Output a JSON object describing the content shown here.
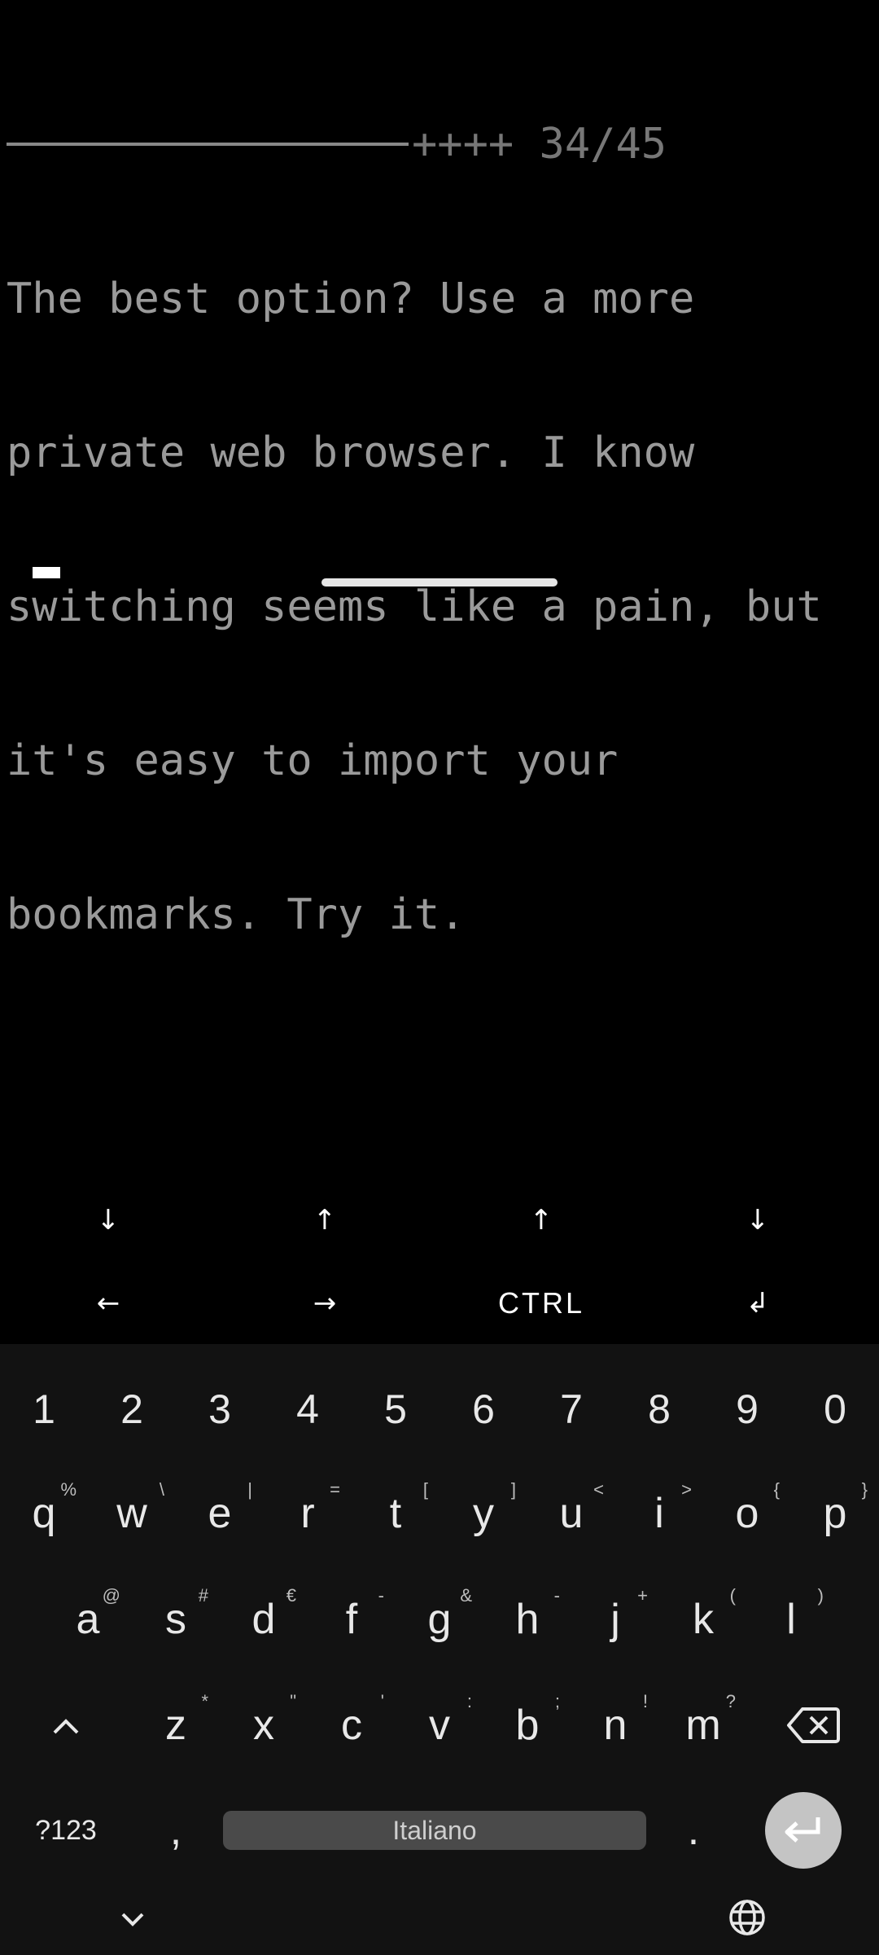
{
  "terminal": {
    "progress_text": "++++ 34/45",
    "lines": [
      "The best option? Use a more",
      "private web browser. I know",
      "switching seems like a pain, but",
      "it's easy to import your",
      "bookmarks. Try it."
    ]
  },
  "extra_keys": {
    "row1": [
      "↓",
      "↑",
      "↑",
      "↓"
    ],
    "row2": [
      "←",
      "→",
      "CTRL",
      "↲"
    ]
  },
  "keyboard": {
    "numbers": [
      "1",
      "2",
      "3",
      "4",
      "5",
      "6",
      "7",
      "8",
      "9",
      "0"
    ],
    "row_q": [
      {
        "key": "q",
        "alt": "%"
      },
      {
        "key": "w",
        "alt": "\\"
      },
      {
        "key": "e",
        "alt": "|"
      },
      {
        "key": "r",
        "alt": "="
      },
      {
        "key": "t",
        "alt": "["
      },
      {
        "key": "y",
        "alt": "]"
      },
      {
        "key": "u",
        "alt": "<"
      },
      {
        "key": "i",
        "alt": ">"
      },
      {
        "key": "o",
        "alt": "{"
      },
      {
        "key": "p",
        "alt": "}"
      }
    ],
    "row_a": [
      {
        "key": "a",
        "alt": "@"
      },
      {
        "key": "s",
        "alt": "#"
      },
      {
        "key": "d",
        "alt": "€"
      },
      {
        "key": "f",
        "alt": "-"
      },
      {
        "key": "g",
        "alt": "&"
      },
      {
        "key": "h",
        "alt": "-"
      },
      {
        "key": "j",
        "alt": "+"
      },
      {
        "key": "k",
        "alt": "("
      },
      {
        "key": "l",
        "alt": ")"
      }
    ],
    "row_z": [
      {
        "key": "z",
        "alt": "*"
      },
      {
        "key": "x",
        "alt": "\""
      },
      {
        "key": "c",
        "alt": "'"
      },
      {
        "key": "v",
        "alt": ":"
      },
      {
        "key": "b",
        "alt": ";"
      },
      {
        "key": "n",
        "alt": "!"
      },
      {
        "key": "m",
        "alt": "?"
      }
    ],
    "symbols_label": "?123",
    "comma": ",",
    "space_label": "Italiano",
    "period": "."
  }
}
